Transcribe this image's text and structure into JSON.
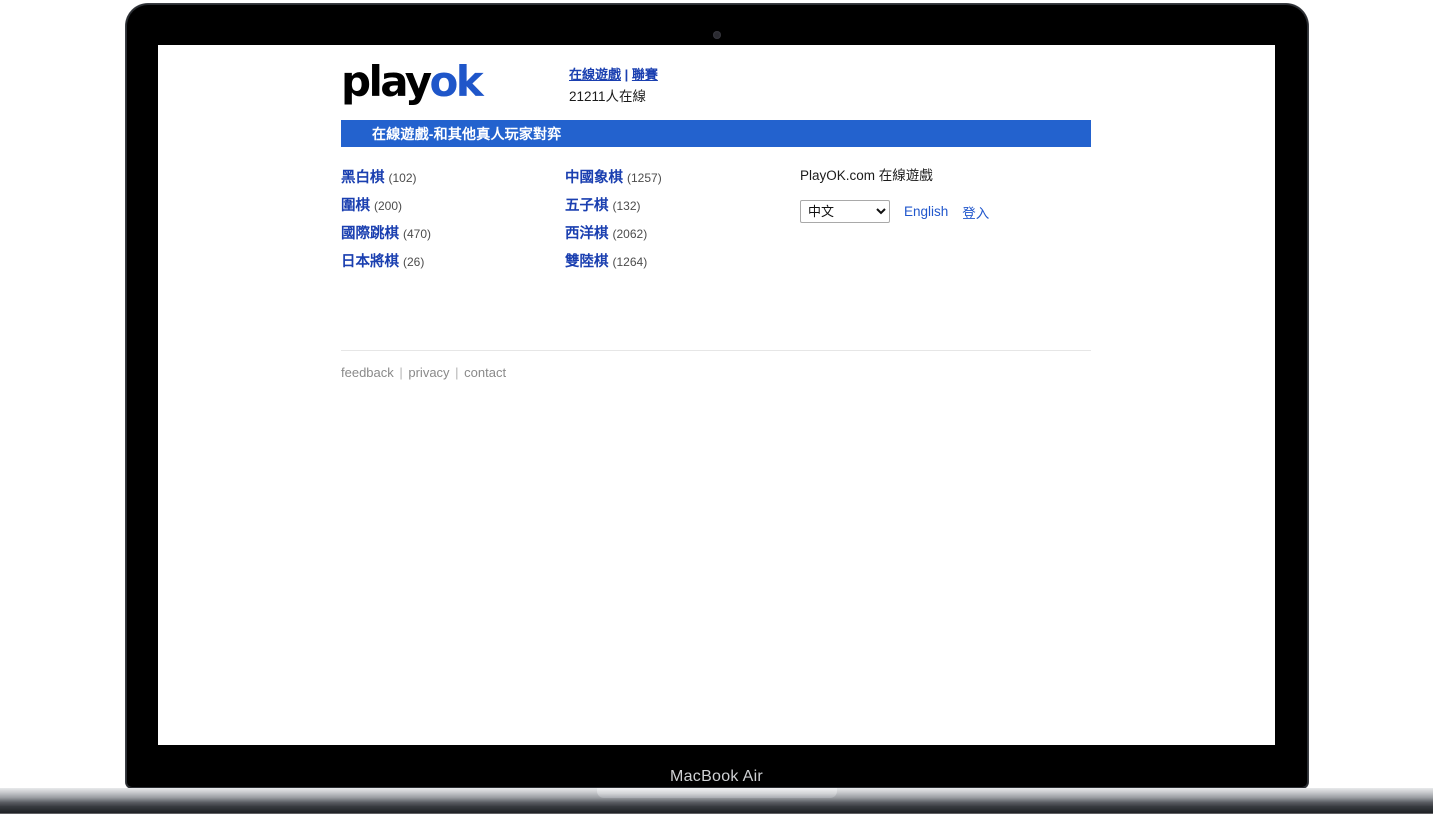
{
  "device": {
    "model_label": "MacBook Air",
    "camera_icon": "camera-dot-icon"
  },
  "site": {
    "logo_main": "play",
    "logo_accent": "ok",
    "brand_color": "#1f56c9"
  },
  "masthead": {
    "nav": [
      {
        "label": "在線遊戲"
      },
      {
        "label": "聯賽"
      }
    ],
    "separator": "|",
    "online_count": "21211人在線"
  },
  "banner": {
    "title": "在線遊戲-和其他真人玩家對弈",
    "background": "#2362ce"
  },
  "games": {
    "column1": [
      {
        "name": "黑白棋",
        "count": "(102)"
      },
      {
        "name": "圍棋",
        "count": "(200)"
      },
      {
        "name": "國際跳棋",
        "count": "(470)"
      },
      {
        "name": "日本將棋",
        "count": "(26)"
      }
    ],
    "column2": [
      {
        "name": "中國象棋",
        "count": "(1257)"
      },
      {
        "name": "五子棋",
        "count": "(132)"
      },
      {
        "name": "西洋棋",
        "count": "(2062)"
      },
      {
        "name": "雙陸棋",
        "count": "(1264)"
      }
    ]
  },
  "side_panel": {
    "title": "PlayOK.com 在線遊戲",
    "language": {
      "selected": "中文",
      "options": [
        "中文",
        "English"
      ],
      "chevron_icon": "chevron-down-icon"
    },
    "english_link": "English",
    "login_link": "登入"
  },
  "footer": {
    "feedback": "feedback",
    "privacy": "privacy",
    "contact": "contact",
    "sep1": "|",
    "sep2": "|"
  }
}
